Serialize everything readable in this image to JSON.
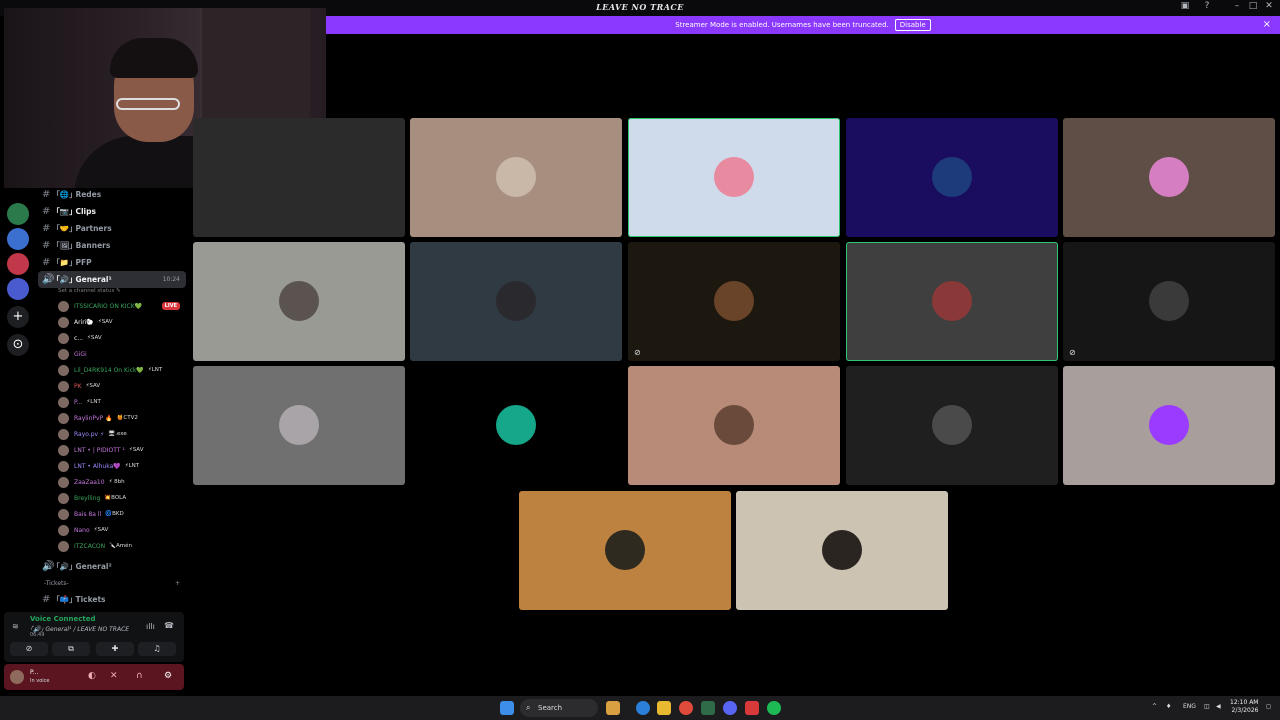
{
  "window": {
    "title": "LEAVE NO TRACE"
  },
  "banner": {
    "text": "Streamer Mode is enabled. Usernames have been truncated.",
    "disable_label": "Disable",
    "close": "×"
  },
  "server_rail": {
    "items": [
      "server-1",
      "server-2",
      "server-3",
      "server-4"
    ],
    "add_label": "+",
    "explore_label": "⊙"
  },
  "channels": [
    {
      "icon": "#",
      "label": "｢🌐｣ Redes"
    },
    {
      "icon": "#",
      "label": "｢📷｣ Clips",
      "active": true
    },
    {
      "icon": "#",
      "label": "｢🤝｣ Partners"
    },
    {
      "icon": "#",
      "label": "｢🖼｣ Banners"
    },
    {
      "icon": "#",
      "label": "｢📁｣ PFP"
    }
  ],
  "voice_channel": {
    "icon": "🔊",
    "label": "｢🔊｣ General¹",
    "time": "10:24",
    "status": "Set a channel status ✎"
  },
  "voice_users": [
    {
      "name": "ITSSICARIO ON KICK💚",
      "badge": "",
      "live": "LIVE",
      "color": "#3ba55d"
    },
    {
      "name": "Ariri🐑",
      "badge": "⚡SAV",
      "color": "#f2f3f5"
    },
    {
      "name": "c...",
      "badge": "⚡SAV",
      "color": "#f2f3f5"
    },
    {
      "name": "GiGi",
      "badge": "",
      "color": "#c678dd"
    },
    {
      "name": "Lil_D4RK914 On Kick💚",
      "badge": "⚡LNT",
      "color": "#3ba55d"
    },
    {
      "name": "PK",
      "badge": "⚡SAV",
      "color": "#e05555"
    },
    {
      "name": "P...",
      "badge": "⚡LNT",
      "color": "#c678dd"
    },
    {
      "name": "RaylinPvP 🔥",
      "badge": "🍯CTV2",
      "color": "#c678dd"
    },
    {
      "name": "Rayo.pv ⚡",
      "badge": "🖥.exe",
      "color": "#9b8cff"
    },
    {
      "name": "LNT • | PIDIOTT ¹",
      "badge": "⚡SAV",
      "color": "#c678dd"
    },
    {
      "name": "LNT • Alhuka💜",
      "badge": "⚡LNT",
      "color": "#9b8cff"
    },
    {
      "name": "ZaaZaa10",
      "badge": "⚡ 8bh",
      "color": "#c678dd"
    },
    {
      "name": "Breylling",
      "badge": "💥BOLA",
      "color": "#3ba55d"
    },
    {
      "name": "Bais 8a ll",
      "badge": "🌀BKD",
      "color": "#c678dd"
    },
    {
      "name": "Nano",
      "badge": "⚡SAV",
      "color": "#c678dd"
    },
    {
      "name": "ITZCACON",
      "badge": "🔪Amén",
      "color": "#3ba55d"
    }
  ],
  "voice_channel_2": {
    "icon": "🔊",
    "label": "｢🔊｣ General²"
  },
  "category": {
    "label": "-Tickets-",
    "add": "+"
  },
  "tickets_channel": {
    "icon": "#",
    "label": "｢📫｣ Tickets"
  },
  "voice_connected": {
    "title": "Voice Connected",
    "channel": "｢🔊｣ General¹ / LEAVE NO TRACE",
    "time": "06:49"
  },
  "user_panel": {
    "name": "P...",
    "status": "In voice"
  },
  "tiles": [
    {
      "bg": "#2b2b2b",
      "avatar": ""
    },
    {
      "bg": "#a88e7f",
      "avatar": "#c9b8a8"
    },
    {
      "bg": "#cfdbeb",
      "avatar": "#e88aa0",
      "speaking": true
    },
    {
      "bg": "#1a0c5e",
      "avatar": "#1d3a7a"
    },
    {
      "bg": "#5e4e45",
      "avatar": "#d67ec2"
    },
    {
      "bg": "#9a9a95",
      "avatar": "#5b5350"
    },
    {
      "bg": "#2f3a42",
      "avatar": "#2a2a2e"
    },
    {
      "bg": "#1c1810",
      "avatar": "#6a4428",
      "muted": true
    },
    {
      "bg": "#3f3f3f",
      "avatar": "#8a3838",
      "speaking": true
    },
    {
      "bg": "#161616",
      "avatar": "#3a3a3a",
      "muted": true
    },
    {
      "bg": "#707070",
      "avatar": "#a8a4a8"
    },
    {
      "bg": "#000000",
      "avatar": "#16a68a"
    },
    {
      "bg": "#b88b78",
      "avatar": "#6a4a3a"
    },
    {
      "bg": "#1f1f1f",
      "avatar": "#4a4a4a"
    },
    {
      "bg": "#a89e9c",
      "avatar": "#9a3cff"
    },
    {
      "bg": "#bd8240",
      "avatar": "#2e2a20"
    },
    {
      "bg": "#ccc3b3",
      "avatar": "#2a2520"
    }
  ],
  "taskbar": {
    "search_label": "Search",
    "lang": "ENG",
    "time": "12:10 AM",
    "date": "2/3/2026"
  }
}
